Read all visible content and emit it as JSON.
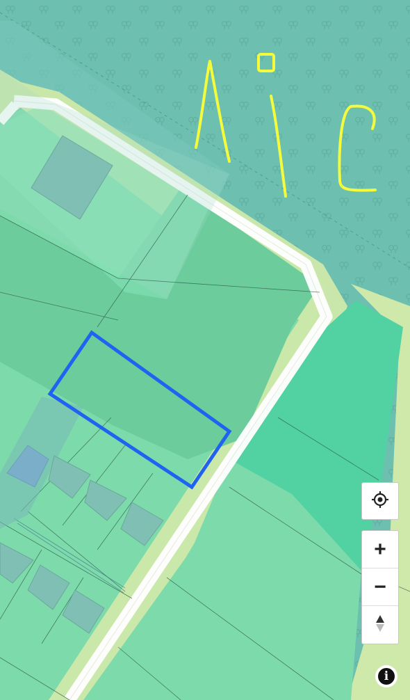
{
  "map": {
    "colors": {
      "forest": "#6dbfb0",
      "meadow": "#7ddbab",
      "meadow_dark": "#6ccc9c",
      "field": "#52d2a2",
      "road_edge": "#cfe9aa",
      "road": "#ffffff",
      "selected_parcel": "#1f63f0",
      "annotation": "#f4fb3c",
      "building": "#7fbfb4",
      "building_blue": "#7aaec9"
    },
    "annotation_text": "AiC",
    "layers": [
      "forest",
      "meadow",
      "road",
      "parcel-boundaries",
      "buildings",
      "selected-parcel"
    ]
  },
  "controls": {
    "locate_icon": "crosshair-icon",
    "zoom_in_label": "+",
    "zoom_out_label": "−",
    "compass_icon": "compass-icon",
    "info_label": "i"
  }
}
